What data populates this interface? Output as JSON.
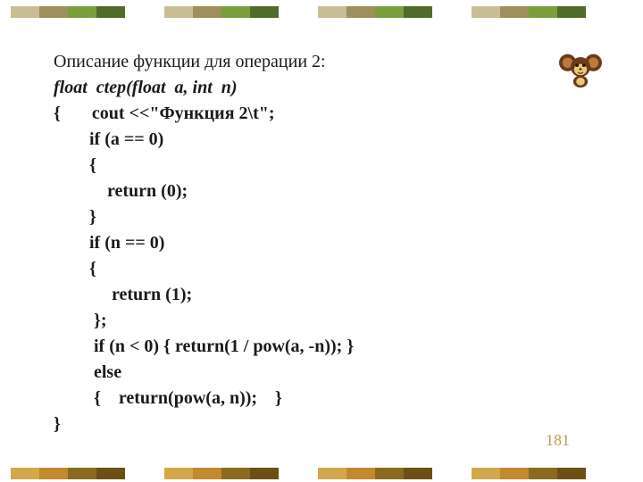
{
  "decor": {
    "top_colors": [
      "#c8bd95",
      "#9e8f5c",
      "#7a9e3d",
      "#516b29",
      "#c8bd95",
      "#9e8f5c",
      "#7a9e3d",
      "#516b29",
      "#c8bd95",
      "#9e8f5c",
      "#7a9e3d",
      "#516b29",
      "#c8bd95",
      "#9e8f5c",
      "#7a9e3d",
      "#516b29"
    ],
    "bottom_colors": [
      "#d2a84a",
      "#c18a2d",
      "#8a6a1f",
      "#6b4f14",
      "#d2a84a",
      "#c18a2d",
      "#8a6a1f",
      "#6b4f14",
      "#d2a84a",
      "#c18a2d",
      "#8a6a1f",
      "#6b4f14",
      "#d2a84a",
      "#c18a2d",
      "#8a6a1f",
      "#6b4f14"
    ]
  },
  "lines": [
    {
      "cls": "",
      "text": "Описание функции для операции 2:"
    },
    {
      "cls": "bolditalic",
      "text": "float  ctep(float  a, int  n)"
    },
    {
      "cls": "bold",
      "text": "{       cout <<\"Функция 2\\t\";"
    },
    {
      "cls": "bold",
      "text": "        if (a == 0)"
    },
    {
      "cls": "bold",
      "text": "        {"
    },
    {
      "cls": "bold",
      "text": "            return (0);"
    },
    {
      "cls": "bold",
      "text": "        }"
    },
    {
      "cls": "bold",
      "text": "        if (n == 0)"
    },
    {
      "cls": "bold",
      "text": "        {"
    },
    {
      "cls": "bold",
      "text": "             return (1);"
    },
    {
      "cls": "bold",
      "text": "         };"
    },
    {
      "cls": "bold",
      "text": "         if (n < 0) { return(1 / pow(a, -n)); }"
    },
    {
      "cls": "bold",
      "text": "         else"
    },
    {
      "cls": "bold",
      "text": "         {    return(pow(a, n));    }"
    },
    {
      "cls": "bold",
      "text": "}"
    }
  ],
  "page_number": "181",
  "mascot_name": "cheburashka-icon"
}
